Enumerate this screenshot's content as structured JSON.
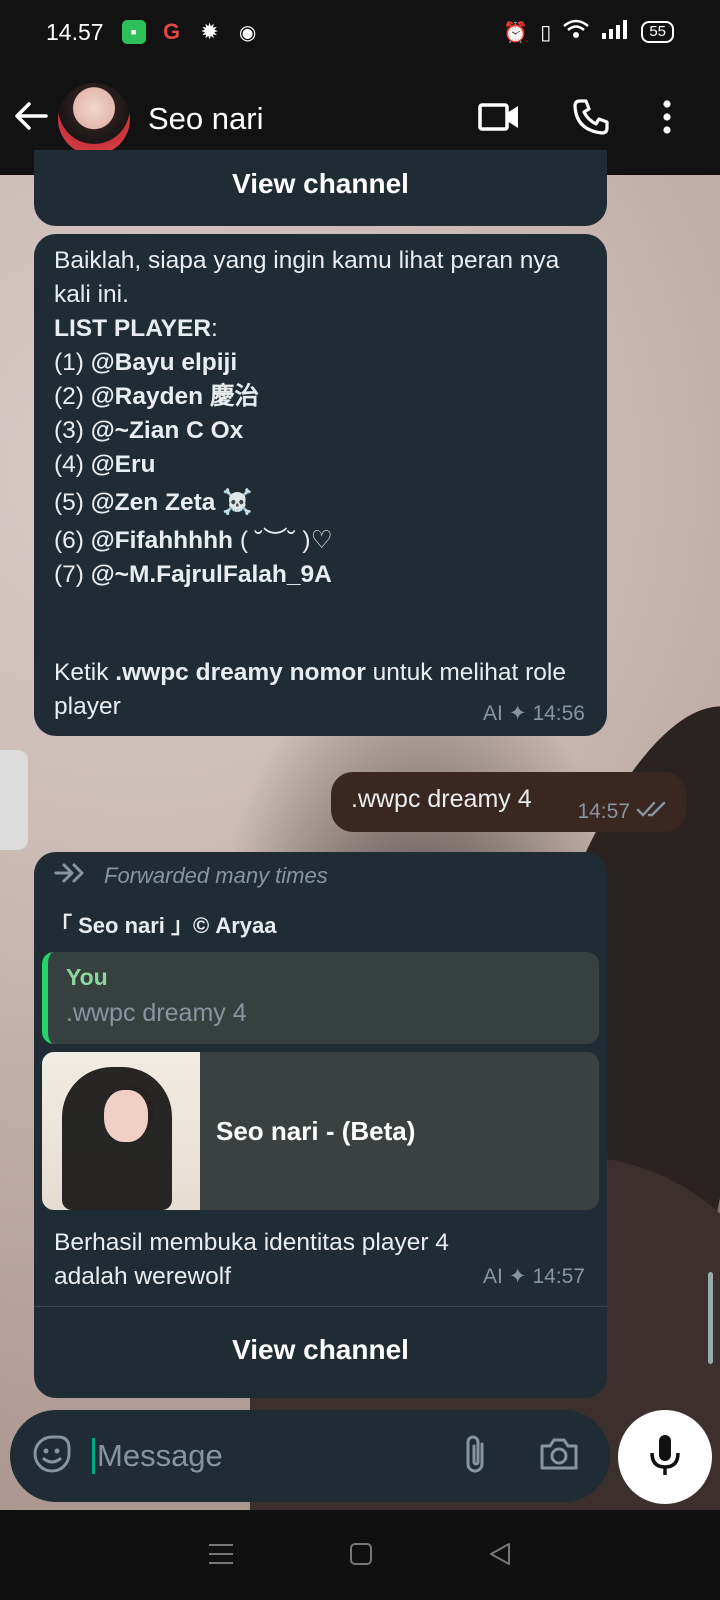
{
  "status": {
    "time": "14.57",
    "battery": "55"
  },
  "header": {
    "name": "Seo nari"
  },
  "messages": {
    "m1": {
      "view_channel": "View channel"
    },
    "m2": {
      "intro": "Baiklah, siapa yang ingin kamu lihat peran nya kali ini.",
      "list_title": "LIST PLAYER",
      "list_colon": ":",
      "players": [
        {
          "num": "(1) ",
          "name": "@Bayu elpiji"
        },
        {
          "num": "(2) ",
          "name": "@Rayden 慶治"
        },
        {
          "num": "(3) ",
          "name": "@~Zian C Ox"
        },
        {
          "num": "(4) ",
          "name": "@Eru"
        },
        {
          "num": "(5) ",
          "name": "@Zen Zeta ☠️"
        },
        {
          "num": "(6) ",
          "name": "@Fifahhhhh",
          "suffix": " ( ˘︶˘ )♡"
        },
        {
          "num": "(7) ",
          "name": "@~M.FajrulFalah_9A"
        }
      ],
      "instruction_pre": "Ketik ",
      "instruction_bold": ".wwpc dreamy nomor",
      "instruction_post": " untuk melihat role player",
      "label": "AI",
      "time": "14:56"
    },
    "m3": {
      "text": ".wwpc dreamy 4",
      "time": "14:57",
      "status": "read"
    },
    "m4": {
      "forwarded": "Forwarded many times",
      "channel": "「 Seo nari 」© Aryaa",
      "quote_author": "You",
      "quote_text": ".wwpc dreamy 4",
      "card_title": "Seo nari - (Beta)",
      "text": "Berhasil membuka identitas player 4 adalah werewolf",
      "label": "AI",
      "time": "14:57",
      "view_channel": "View channel"
    }
  },
  "input": {
    "placeholder": "Message"
  },
  "colors": {
    "incoming": "#202c33",
    "outgoing": "#3b2721",
    "accent": "#00a884",
    "quote_author": "#53bdeb"
  }
}
